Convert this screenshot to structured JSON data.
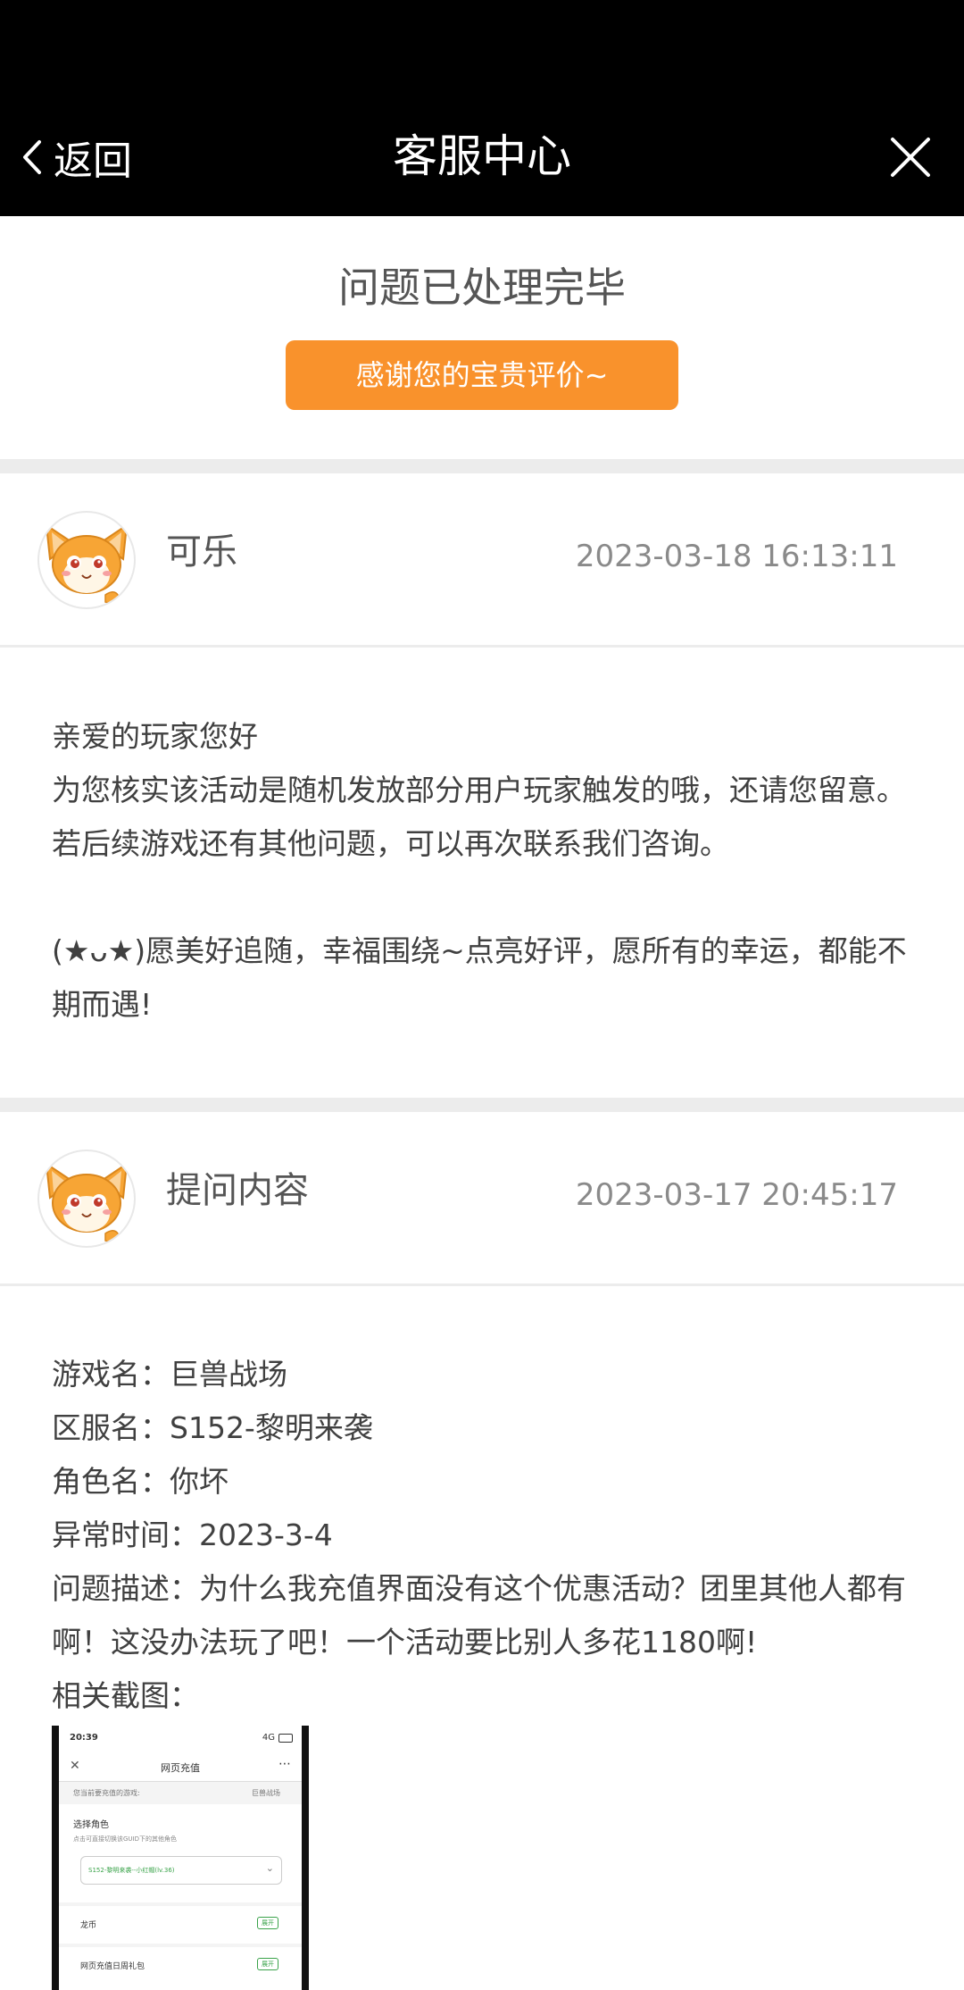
{
  "nav": {
    "back_label": "返回",
    "title": "客服中心"
  },
  "status": {
    "title": "问题已处理完毕",
    "rate_button": "感谢您的宝贵评价~"
  },
  "reply": {
    "sender": "可乐",
    "timestamp": "2023-03-18 16:13:11",
    "lines": [
      "亲爱的玩家您好",
      "为您核实该活动是随机发放部分用户玩家触发的哦，还请您留意。若后续游戏还有其他问题，可以再次联系我们咨询。",
      "(★ᴗ★)愿美好追随，幸福围绕~点亮好评，愿所有的幸运，都能不期而遇!"
    ]
  },
  "question": {
    "sender": "提问内容",
    "timestamp": "2023-03-17 20:45:17",
    "game": "游戏名：巨兽战场",
    "server": "区服名：S152-黎明来袭",
    "role": "角色名：你坏",
    "time": "异常时间：2023-3-4",
    "description": "问题描述：为什么我充值界面没有这个优惠活动？团里其他人都有啊！这没办法玩了吧！一个活动要比别人多花1180啊!",
    "screenshot_label": "相关截图："
  },
  "screenshot": {
    "time": "20:39",
    "signal": "4G",
    "title": "网页充值",
    "game_prompt": "您当前要充值的游戏:",
    "game_name": "巨兽战场",
    "select_role": "选择角色",
    "role_hint": "点击可直接切换该GUID下的其他角色",
    "role_value": "S152-黎明来袭--小红帽(lv.36)",
    "item1": "龙币",
    "item2": "网页充值日周礼包",
    "expand": "展开"
  },
  "colors": {
    "accent": "#f9922c",
    "nav_bg": "#000000",
    "divider": "#ececec"
  }
}
